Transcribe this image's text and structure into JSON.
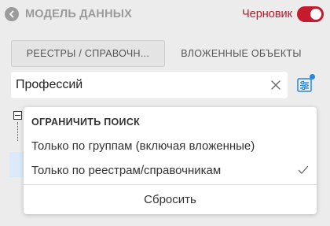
{
  "header": {
    "title": "МОДЕЛЬ ДАННЫХ",
    "draft_label": "Черновик",
    "draft_enabled": true,
    "accent_color": "#c51b2d"
  },
  "tabs": [
    {
      "label": "РЕЕСТРЫ / СПРАВОЧН...",
      "active": true
    },
    {
      "label": "ВЛОЖЕННЫЕ ОБЪЕКТЫ",
      "active": false
    }
  ],
  "search": {
    "value": "Професcий",
    "clear_icon": "close-icon",
    "filter_icon": "filter-settings-icon",
    "filter_indicator_color": "#2a86d6"
  },
  "dropdown": {
    "heading": "ОГРАНИЧИТЬ ПОИСК",
    "options": [
      {
        "label": "Только по группам (включая вложенные)",
        "checked": false
      },
      {
        "label": "Только по реестрам/справочникам",
        "checked": true
      }
    ],
    "reset_label": "Сбросить"
  }
}
